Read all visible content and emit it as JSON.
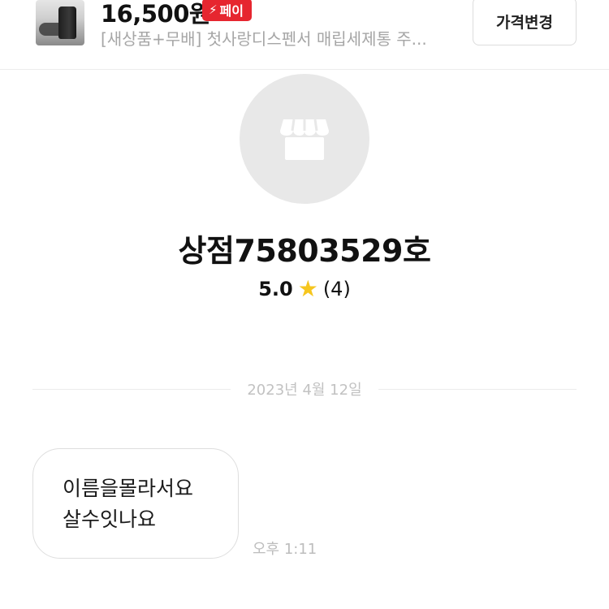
{
  "product": {
    "price": "16,500원",
    "pay_badge": "페이",
    "title": "[새상품+무배] 첫사랑디스펜서 매립세제통 주...",
    "price_change_button": "가격변경"
  },
  "shop": {
    "name": "상점75803529호",
    "rating_score": "5.0",
    "review_count": "(4)"
  },
  "chat": {
    "date_divider": "2023년 4월 12일",
    "messages": [
      {
        "lines": [
          "이름을몰라서요",
          "살수잇나요"
        ],
        "time": "오후 1:11"
      }
    ]
  },
  "colors": {
    "pay_badge": "#e6262f",
    "star": "#f6c61e",
    "avatar_bg": "#e8e8e8"
  },
  "icons": {
    "avatar": "store-icon",
    "rating": "star-icon",
    "pay": "lightning-icon"
  }
}
